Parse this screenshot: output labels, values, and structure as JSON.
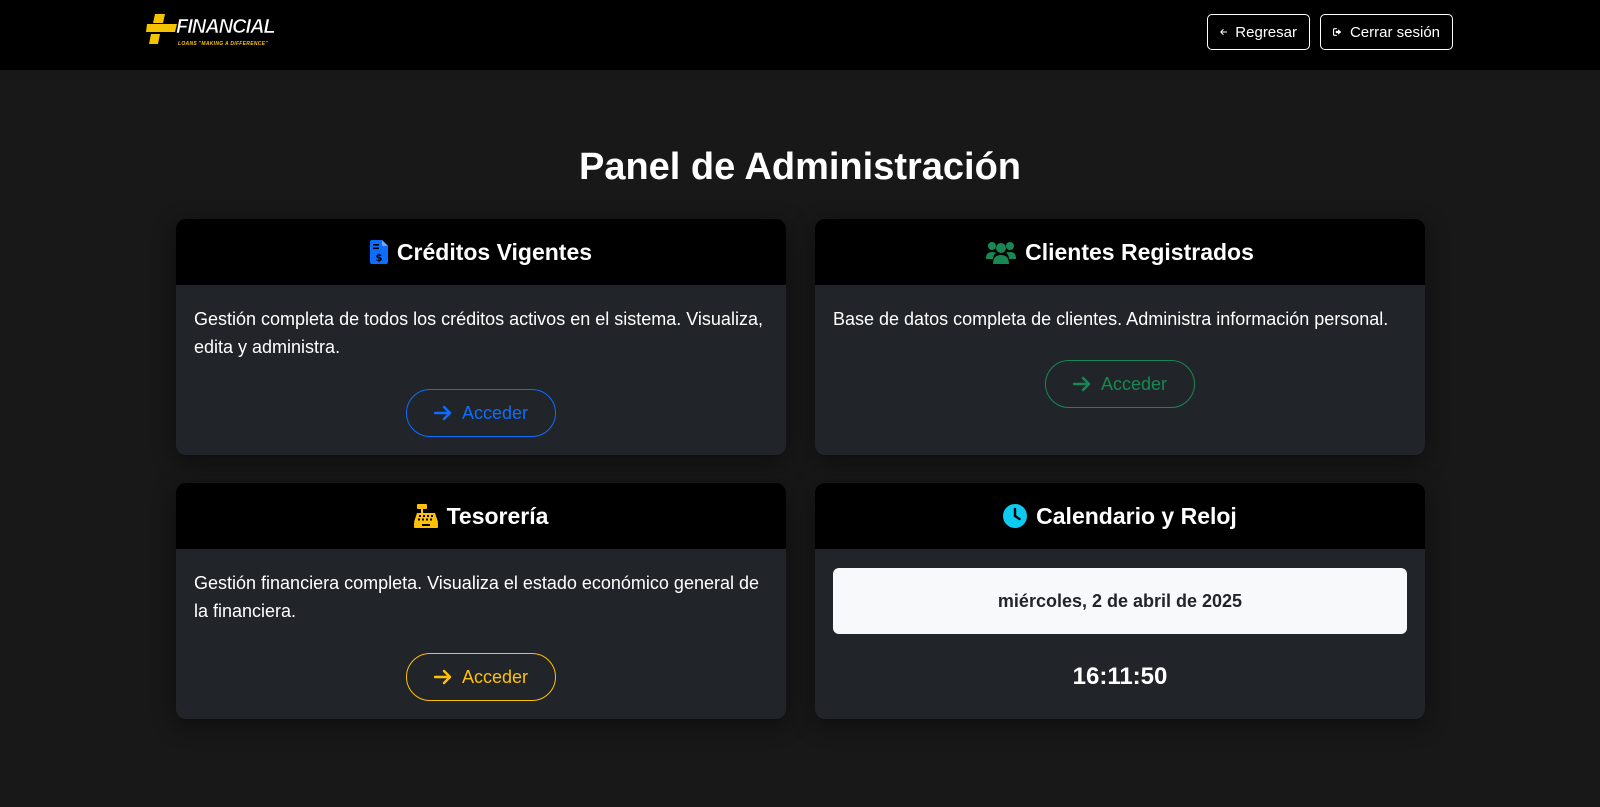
{
  "header": {
    "logo_text": "FINANCIAL",
    "logo_subtext": "LOANS \"MAKING A DIFFERENCE\"",
    "back_label": "Regresar",
    "logout_label": "Cerrar sesión"
  },
  "page": {
    "title": "Panel de Administración"
  },
  "cards": [
    {
      "title": "Créditos Vigentes",
      "icon": "invoice-dollar-icon",
      "description": "Gestión completa de todos los créditos activos en el sistema. Visualiza, edita y administra.",
      "button_label": "Acceder",
      "accent": "#0d6efd"
    },
    {
      "title": "Clientes Registrados",
      "icon": "users-icon",
      "description": "Base de datos completa de clientes. Administra información personal.",
      "button_label": "Acceder",
      "accent": "#198754"
    },
    {
      "title": "Tesorería",
      "icon": "cash-register-icon",
      "description": "Gestión financiera completa. Visualiza el estado económico general de la financiera.",
      "button_label": "Acceder",
      "accent": "#ffc107"
    },
    {
      "title": "Calendario y Reloj",
      "icon": "clock-icon",
      "date": "miércoles, 2 de abril de 2025",
      "time": "16:11:50",
      "accent": "#0dcaf0"
    }
  ],
  "colors": {
    "background": "#181818",
    "topbar": "#000000",
    "card": "#212529",
    "logo_yellow": "#f5c400"
  }
}
